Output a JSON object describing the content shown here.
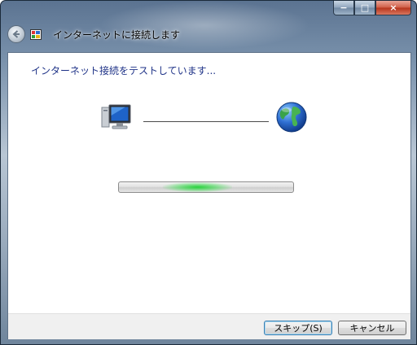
{
  "window": {
    "title": "インターネットに接続します",
    "caption": {
      "minimize": "−",
      "maximize": "□",
      "close": "×"
    }
  },
  "nav": {
    "back_icon": "back-arrow-icon",
    "wizard_icon": "network-wizard-icon"
  },
  "main": {
    "heading": "インターネット接続をテストしています...",
    "progress": {
      "state": "indeterminate",
      "accent": "#2fd24a"
    },
    "icons": {
      "computer": "computer-icon",
      "globe": "globe-icon"
    }
  },
  "footer": {
    "skip_label": "スキップ(S)",
    "cancel_label": "キャンセル"
  },
  "colors": {
    "heading": "#1e3287",
    "frame": "#7b93ad"
  }
}
